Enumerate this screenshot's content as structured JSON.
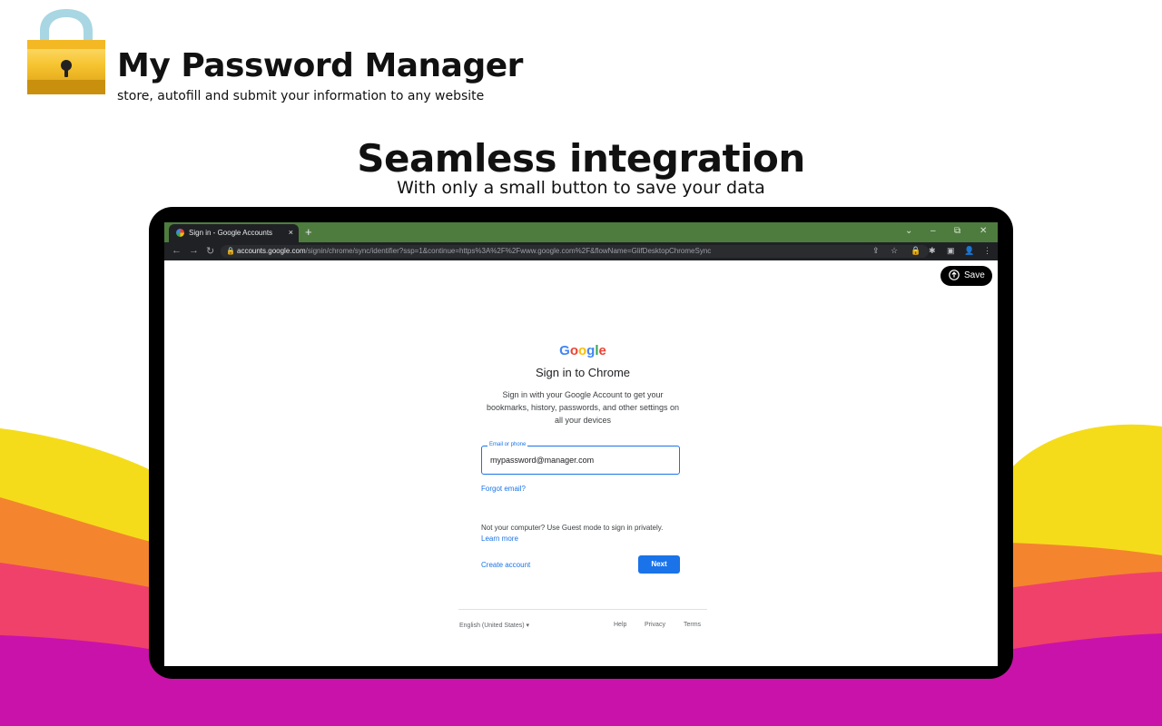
{
  "header": {
    "title": "My Password Manager",
    "subtitle": "store, autofill and submit your information to any website"
  },
  "hero": {
    "title": "Seamless integration",
    "subtitle": "With only a small button to save your data"
  },
  "browser": {
    "tab_title": "Sign in - Google Accounts",
    "tab_close": "×",
    "new_tab": "+",
    "url_host": "accounts.google.com",
    "url_rest": "/signin/chrome/sync/identifier?ssp=1&continue=https%3A%2F%2Fwww.google.com%2F&flowName=GlifDesktopChromeSync",
    "window_controls": [
      "⌄",
      "–",
      "⧉",
      "✕"
    ]
  },
  "save_button": {
    "label": "Save"
  },
  "signin": {
    "logo": "Google",
    "heading": "Sign in to Chrome",
    "description": "Sign in with your Google Account to get your bookmarks, history, passwords, and other settings on all your devices",
    "email_label": "Email or phone",
    "email_value": "mypassword@manager.com",
    "forgot_email": "Forgot email?",
    "guest_note": "Not your computer? Use Guest mode to sign in privately.",
    "learn_more": "Learn more",
    "create_account": "Create account",
    "next": "Next"
  },
  "footer": {
    "language": "English (United States)",
    "help": "Help",
    "privacy": "Privacy",
    "terms": "Terms"
  },
  "colors": {
    "tab_bar": "#4e7c3f",
    "google_blue": "#1a73e8",
    "wave_yellow": "#f5dc1a",
    "wave_orange": "#f4852e",
    "wave_pink": "#f0416a",
    "wave_magenta": "#c912a9"
  }
}
